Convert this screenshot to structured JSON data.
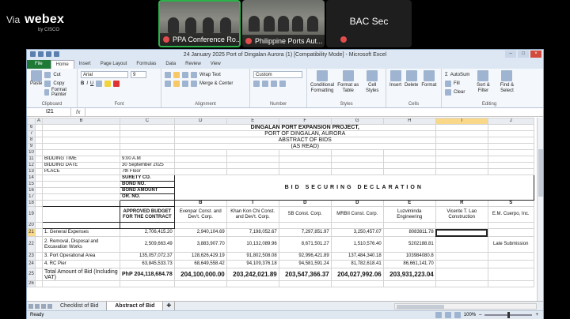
{
  "webex": {
    "via": "Via",
    "brand": "webex",
    "brand_sub": "by CISCO",
    "participants": [
      {
        "label": "PPA Conference Ro..."
      },
      {
        "label": "Philippine Ports Aut..."
      },
      {
        "label": "BAC Sec"
      }
    ]
  },
  "excel": {
    "title": "24 January 2025 Port of Dingalan Aurora (1) [Compatibility Mode] - Microsoft Excel",
    "ribbon_tabs": [
      "File",
      "Home",
      "Insert",
      "Page Layout",
      "Formulas",
      "Data",
      "Review",
      "View"
    ],
    "ribbon": {
      "clipboard": {
        "paste": "Paste",
        "cut": "Cut",
        "copy": "Copy",
        "format_painter": "Format Painter",
        "label": "Clipboard"
      },
      "font": {
        "name": "Arial",
        "size": "9",
        "label": "Font"
      },
      "alignment": {
        "wrap": "Wrap Text",
        "merge": "Merge & Center",
        "label": "Alignment"
      },
      "number": {
        "format": "Custom",
        "label": "Number"
      },
      "styles": {
        "conditional": "Conditional Formatting",
        "format_table": "Format as Table",
        "cell_styles": "Cell Styles",
        "label": "Styles"
      },
      "cells": {
        "insert": "Insert",
        "delete": "Delete",
        "format": "Format",
        "label": "Cells"
      },
      "editing": {
        "autosum": "AutoSum",
        "fill": "Fill",
        "clear": "Clear",
        "sort": "Sort & Filter",
        "find": "Find & Select",
        "label": "Editing"
      }
    },
    "name_box": "I21",
    "fx": "fx",
    "columns": [
      "A",
      "B",
      "C",
      "D",
      "E",
      "F",
      "G",
      "H",
      "I",
      "J"
    ],
    "selected_col": "I",
    "selected_row": "21",
    "heading": {
      "l1": "DINGALAN PORT EXPANSION PROJECT,",
      "l2": "PORT OF DINGALAN, AURORA",
      "l3": "ABSTRACT OF BIDS",
      "l4": "(AS READ)"
    },
    "bidding": {
      "time_label": "BIDDING TIME",
      "time_value": "9:00 A.M",
      "date_label": "BIDDING DATE",
      "date_value": "30 September 2025",
      "place_label": "PLACE",
      "place_value": "7th Floor"
    },
    "surety": [
      "SURETY CO.",
      "BOND NO.",
      "BOND AMOUNT",
      "OR. NO."
    ],
    "bid_securing": "BID SECURING DECLARATION",
    "sub_letters": [
      "B",
      "I",
      "D",
      "D",
      "E",
      "R",
      "S"
    ],
    "approved_budget_header": "APPROVED BUDGET FOR THE CONTRACT",
    "bidders": [
      "Evenpar Const. and Dev't. Corp.",
      "Khan Kon Chi Const. and Dev't. Corp.",
      "SB Const. Corp.",
      "MRBII Const. Corp.",
      "Luzviminda Engineering",
      "Vicente T. Lao Construction",
      "E.M. Cuerpo, Inc."
    ],
    "rows": [
      {
        "num": "21",
        "item": "1. General Expenses",
        "abc": "2,706,415.20",
        "v": [
          "2,940,104.69",
          "7,198,052.67",
          "7,297,851.97",
          "3,250,457.07",
          "8083811.78",
          "",
          ""
        ]
      },
      {
        "num": "22",
        "item": "2. Removal, Disposal and Excavation Works",
        "abc": "2,509,663.49",
        "v": [
          "3,883,907.70",
          "10,132,089.96",
          "8,671,501.27",
          "1,510,576.40",
          "5202188.81",
          "",
          "Late Submission"
        ]
      },
      {
        "num": "23",
        "item": "3. Port Operational Area",
        "abc": "135,057,072.37",
        "v": [
          "128,626,429.19",
          "91,802,508.08",
          "92,996,421.89",
          "137,484,340.18",
          "103984080.8",
          "",
          ""
        ]
      },
      {
        "num": "24",
        "item": "4. RC Pier",
        "abc": "63,845,533.73",
        "v": [
          "68,649,558.42",
          "94,109,376.18",
          "94,581,591.24",
          "81,782,618.41",
          "86,661,141.70",
          "",
          ""
        ]
      }
    ],
    "total": {
      "label": "Total Amount of Bid (Including VAT)",
      "abc": "PhP 204,118,684.78",
      "v": [
        "204,100,000.00",
        "203,242,021.89",
        "203,547,366.37",
        "204,027,992.06",
        "203,931,223.04",
        "",
        ""
      ]
    },
    "sheet_tabs": [
      "Checklist of Bid",
      "Abstract of Bid"
    ],
    "active_sheet": "Abstract of Bid",
    "status": "Ready",
    "zoom": "100%"
  }
}
